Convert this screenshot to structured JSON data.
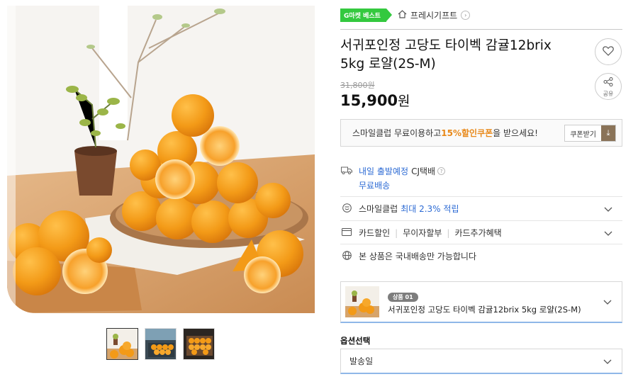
{
  "gallery": {
    "main_alt": "tangerine product photo",
    "thumbnail_count": 3
  },
  "header": {
    "badge": "G마켓 베스트",
    "shop_name": "프레시기프트",
    "shop_icon": "home-icon",
    "shop_chevron": "›"
  },
  "product": {
    "title": "서귀포인정 고당도 타이벡 감귤12brix 5kg 로얄(2S-M)",
    "original_price": "31,800원",
    "sale_price_number": "15,900",
    "sale_price_unit": "원",
    "share_label": "공유"
  },
  "coupon": {
    "text_before": "스마일클럽 무료이용하고 ",
    "highlight": "15%할인쿠폰",
    "text_after": " 을 받으세요!",
    "button_label": "쿠폰받기",
    "button_icon": "⤓"
  },
  "delivery": {
    "date_text": "내일 출발예정",
    "carrier": "CJ택배",
    "help_icon": "?",
    "fee_text": "무료배송"
  },
  "smile": {
    "label": "스마일클럽",
    "highlight": "최대 2.3% 적립"
  },
  "card": {
    "items": [
      "카드할인",
      "무이자할부",
      "카드추가혜택"
    ]
  },
  "shipping_notice": "본 상품은 국내배송만 가능합니다",
  "option_card": {
    "badge": "상품 01",
    "text": "서귀포인정 고당도 타이벡 감귤12brix 5kg 로얄(2S-M)"
  },
  "option_select": {
    "label": "옵션선택",
    "placeholder": "발송일"
  },
  "colors": {
    "badge_green": "#34c93f",
    "link_blue": "#2d6bd4",
    "coupon_orange": "#e8891a",
    "coupon_button_brown": "#8a7358"
  }
}
